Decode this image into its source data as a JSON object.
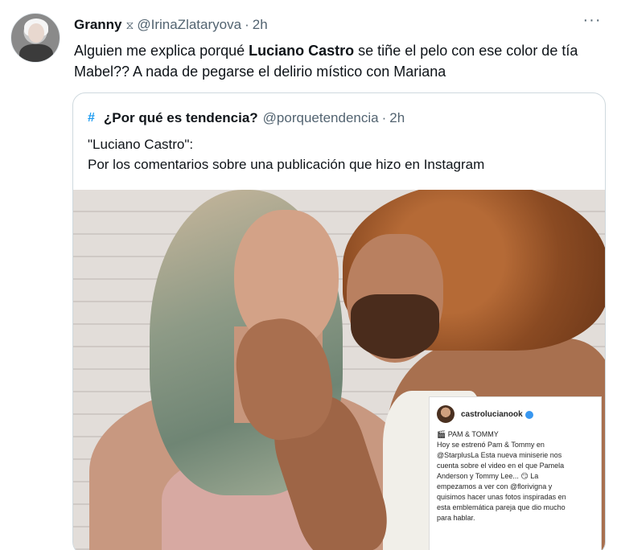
{
  "tweet": {
    "author_name": "Granny",
    "badge_icon": "hourglass-icon",
    "handle": "@IrinaZlataryova",
    "separator": "·",
    "time": "2h",
    "more_label": "···",
    "text_part1": "Alguien me explica porqué ",
    "text_bold": "Luciano Castro",
    "text_part2": " se tiñe el pelo con ese color de tía Mabel?? A nada de pegarse el delirio místico con Mariana"
  },
  "quoted_tweet": {
    "hash_icon": "#",
    "author_name": "¿Por qué es tendencia?",
    "handle": "@porquetendencia",
    "separator": "·",
    "time": "2h",
    "line1": "\"Luciano Castro\":",
    "line2": "Por los comentarios sobre una publicación que hizo en Instagram"
  },
  "instagram_card": {
    "username": "castrolucianook",
    "caption_lines": [
      "🎬 PAM & TOMMY",
      "Hoy se estrenó Pam & Tommy en",
      "@StarplusLa Esta nueva miniserie nos",
      "cuenta sobre el video en el que Pamela",
      "Anderson y Tommy Lee... 😏 La",
      "empezamos a ver con @florivigna y",
      "quisimos hacer unas fotos inspiradas en",
      "esta emblemática pareja que dio mucho",
      "para hablar."
    ]
  },
  "colors": {
    "text_primary": "#0f1419",
    "text_secondary": "#536471",
    "accent": "#1d9bf0",
    "border": "#cfd9de"
  }
}
